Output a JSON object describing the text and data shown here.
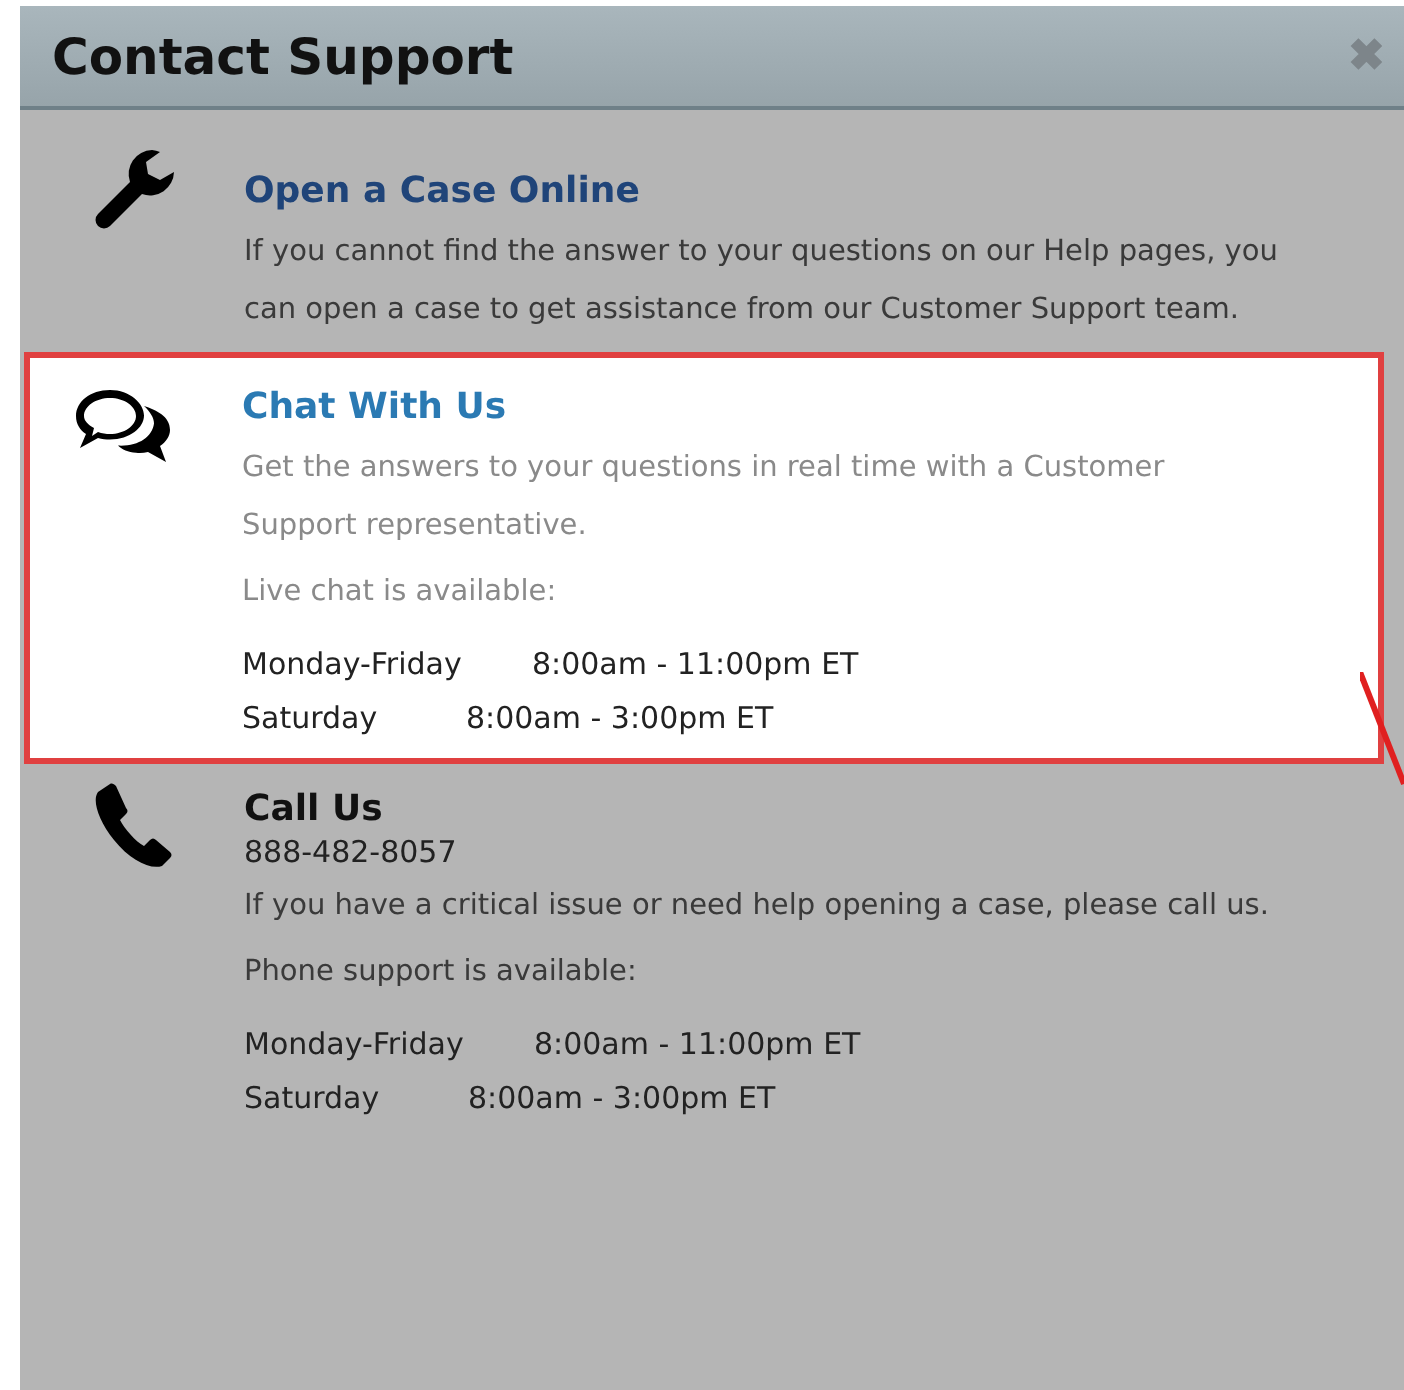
{
  "dialog": {
    "title": "Contact Support",
    "close": "✖"
  },
  "sections": [
    {
      "highlighted": false,
      "kind": "case",
      "title": "Open a Case Online",
      "paragraphs": [
        "If you cannot find the answer to your questions on our Help pages, you can open a case to get assistance from our Customer Support team."
      ]
    },
    {
      "highlighted": true,
      "kind": "chat",
      "title": "Chat With Us",
      "paragraphs": [
        "Get the answers to your questions in real time with a Customer Support representative.",
        "Live chat is available:"
      ],
      "schedule": [
        {
          "days": "Monday-Friday",
          "hours": "8:00am - 11:00pm ET"
        },
        {
          "days": "Saturday",
          "hours": "8:00am - 3:00pm ET"
        }
      ]
    },
    {
      "highlighted": false,
      "kind": "call",
      "title": "Call Us",
      "phone": "888-482-8057",
      "paragraphs": [
        "If you have a critical issue or need help opening a case, please call us.",
        "Phone support is available:"
      ],
      "schedule": [
        {
          "days": "Monday-Friday",
          "hours": "8:00am - 11:00pm ET"
        },
        {
          "days": "Saturday",
          "hours": "8:00am - 3:00pm ET"
        }
      ]
    }
  ]
}
